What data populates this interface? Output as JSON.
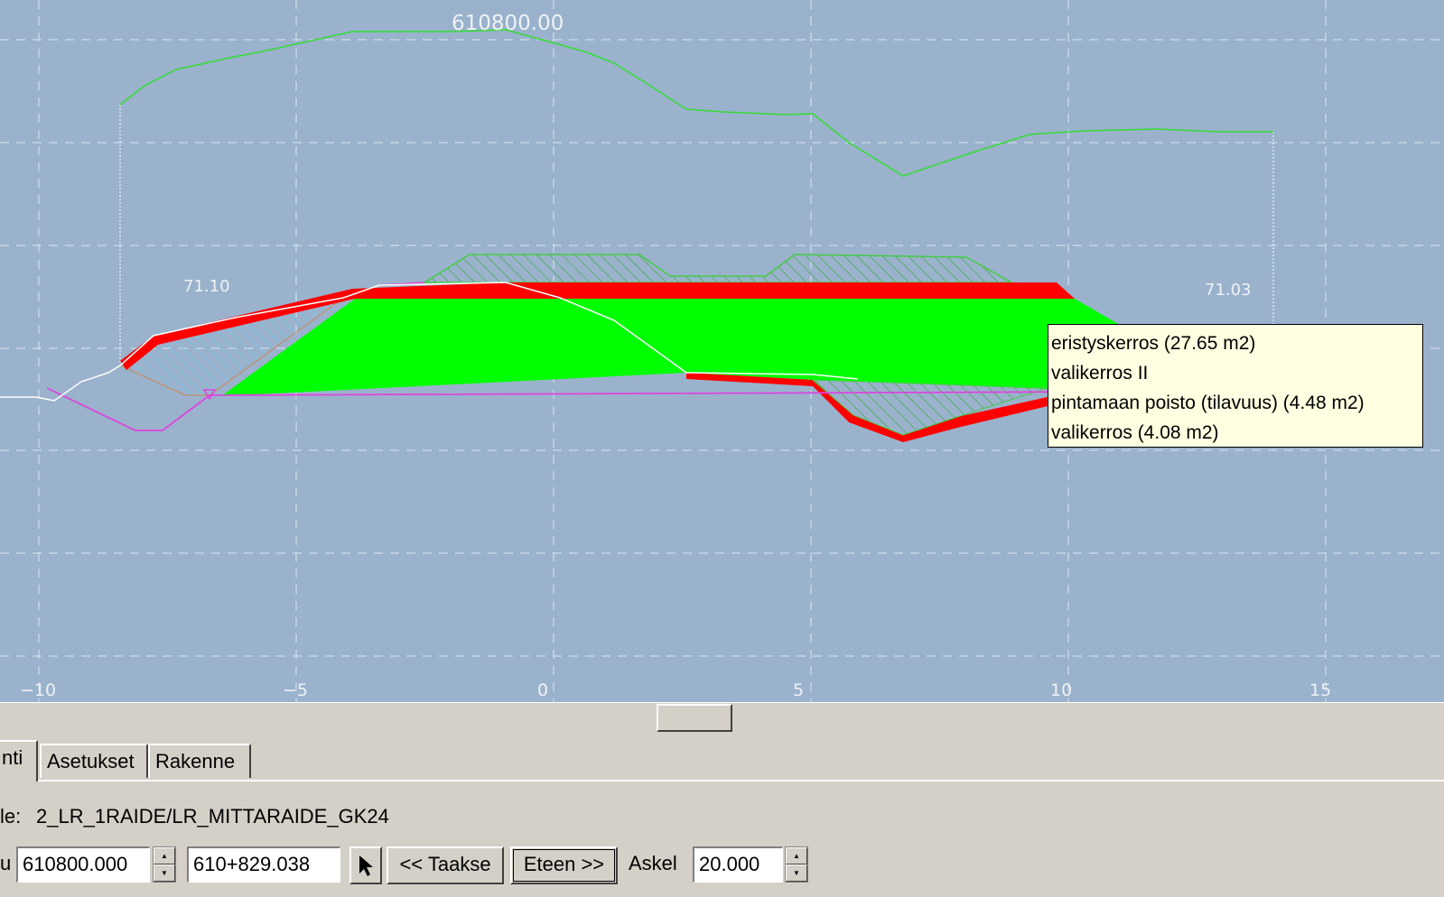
{
  "canvas": {
    "station_label": "610800.00",
    "left_elevation": "71.10",
    "right_elevation": "71.03",
    "x_ticks": [
      "−10",
      "−5",
      "0",
      "5",
      "10",
      "15"
    ],
    "colors": {
      "background": "#9ab2cc",
      "grid": "#e8eef6",
      "terrain": "#33dd33",
      "embankment": "#00ff00",
      "layer": "#ff0000",
      "outline": "#dd44dd",
      "ground": "#ffffff"
    }
  },
  "tooltip": {
    "lines": [
      "eristyskerros (27.65 m2)",
      "valikerros II",
      "pintamaan poisto (tilavuus) (4.48 m2)",
      "valikerros (4.08 m2)"
    ]
  },
  "tabs": [
    "nti",
    "Asetukset",
    "Rakenne"
  ],
  "file_row": {
    "label": "le:",
    "value": "2_LR_1RAIDE/LR_MITTARAIDE_GK24"
  },
  "controls": {
    "left_label": "u",
    "station_value": "610800.000",
    "km_value": "610+829.038",
    "back_label": "<< Taakse",
    "forward_label": "Eteen >>",
    "step_label": "Askel",
    "step_value": "20.000"
  }
}
